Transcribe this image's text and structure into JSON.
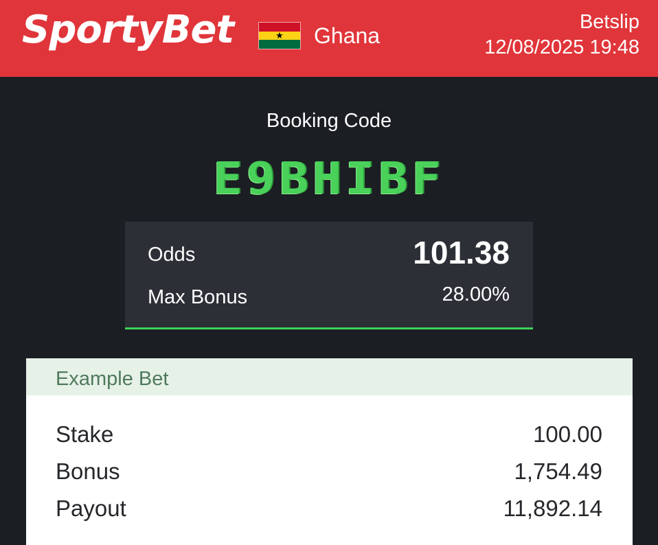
{
  "header": {
    "brand": "SportyBet",
    "flag_icon": "ghana-flag-icon",
    "country": "Ghana",
    "title": "Betslip",
    "datetime": "12/08/2025 19:48",
    "background_color": "#e0353a"
  },
  "booking": {
    "label": "Booking Code",
    "code": "E9BHIBF",
    "code_color": "#49d15a"
  },
  "odds_card": {
    "odds_label": "Odds",
    "odds_value": "101.38",
    "max_bonus_label": "Max Bonus",
    "max_bonus_value": "28.00%",
    "accent_color": "#3dd15a"
  },
  "example_bet": {
    "title": "Example Bet",
    "rows": [
      {
        "label": "Stake",
        "value": "100.00"
      },
      {
        "label": "Bonus",
        "value": "1,754.49"
      },
      {
        "label": "Payout",
        "value": "11,892.14"
      }
    ]
  }
}
